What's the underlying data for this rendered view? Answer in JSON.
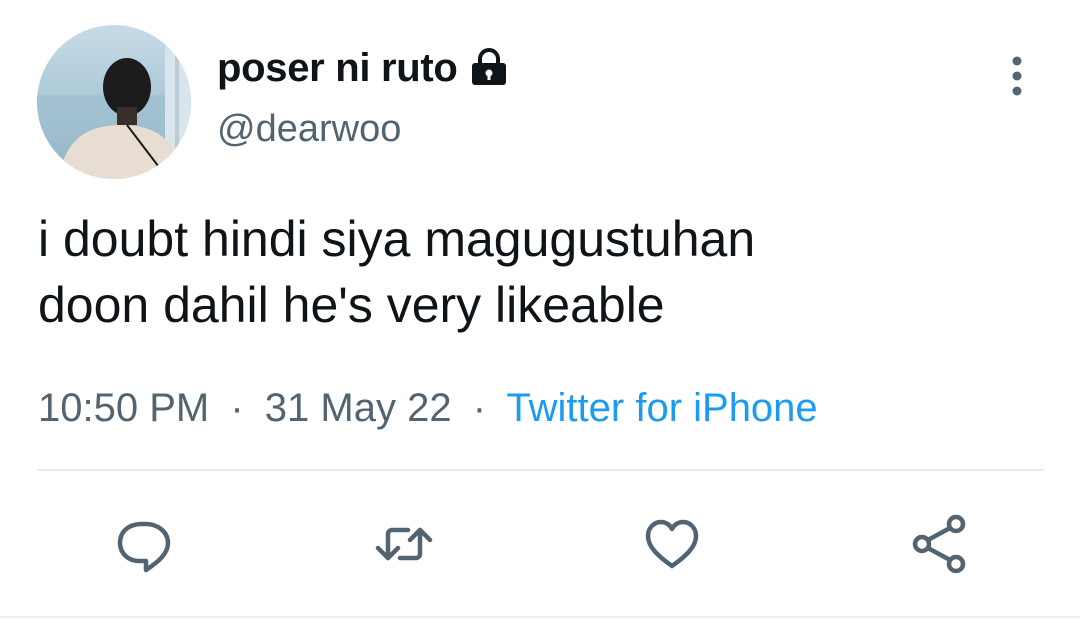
{
  "tweet": {
    "display_name": "poser ni ruto",
    "handle": "@dearwoo",
    "text_lines": [
      "i doubt hindi siya magugustuhan",
      "doon dahil he's very likeable"
    ],
    "time": "10:50 PM",
    "date": "31 May 22",
    "separator": "·",
    "source": "Twitter for iPhone",
    "protected_icon": "lock-icon"
  },
  "actions": {
    "reply_icon": "reply-icon",
    "retweet_icon": "retweet-icon",
    "like_icon": "heart-icon",
    "share_icon": "share-icon",
    "more_icon": "more-vertical-icon"
  },
  "colors": {
    "text": "#0f1419",
    "secondary": "#536471",
    "link": "#1d9bf0",
    "divider": "#e6ecf0"
  }
}
